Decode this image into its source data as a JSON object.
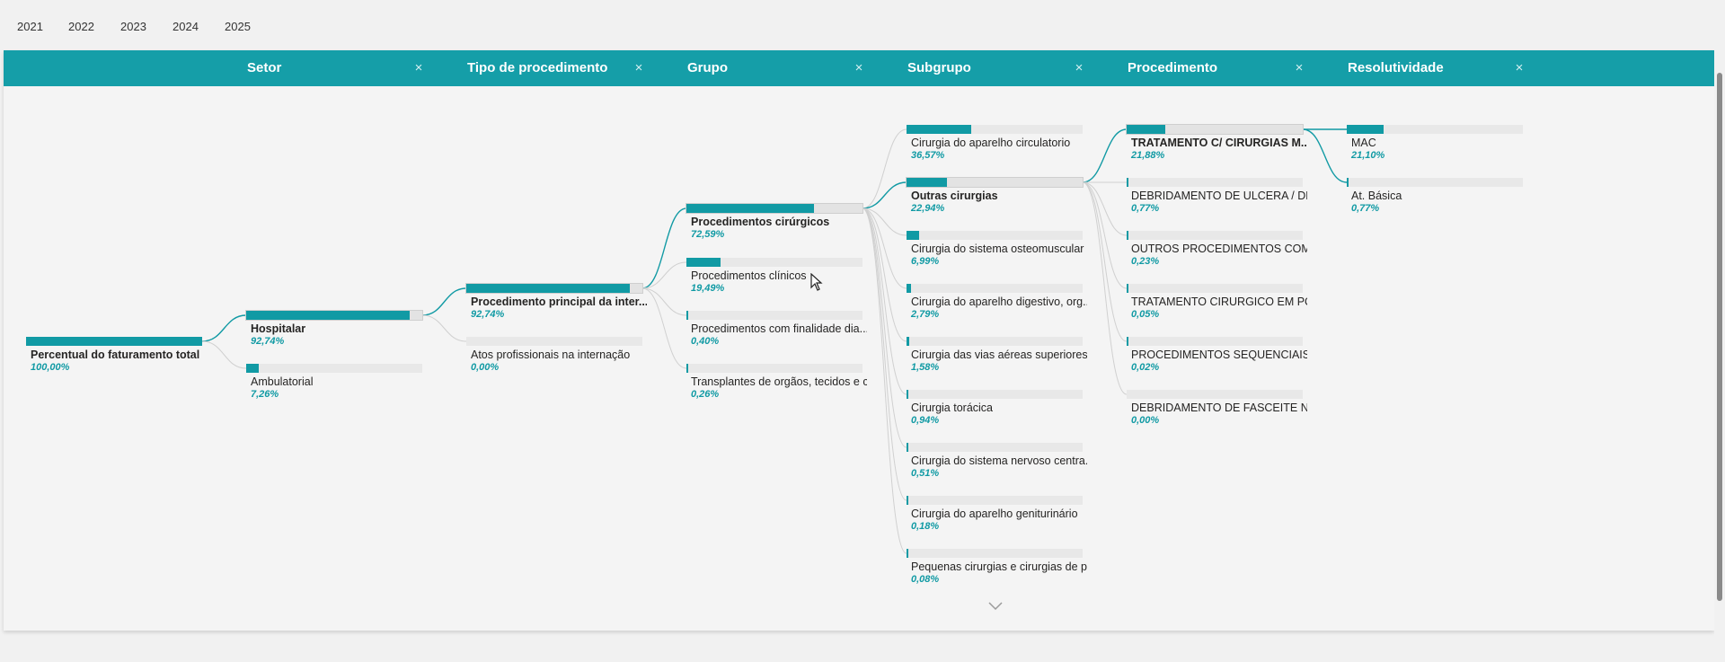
{
  "years": [
    "2021",
    "2022",
    "2023",
    "2024",
    "2025"
  ],
  "columns": [
    {
      "title": "Setor"
    },
    {
      "title": "Tipo de procedimento"
    },
    {
      "title": "Grupo"
    },
    {
      "title": "Subgrupo"
    },
    {
      "title": "Procedimento"
    },
    {
      "title": "Resolutividade"
    }
  ],
  "close_glyph": "×",
  "colors": {
    "accent": "#119aa4",
    "header": "#159ea8",
    "track": "#e8e8e8",
    "link_active": "#119aa4",
    "link_inactive": "#d0d0d0"
  },
  "tree": {
    "root": {
      "label": "Percentual do faturamento total",
      "pct": "100,00%",
      "value": 100.0
    },
    "setor": [
      {
        "label": "Hospitalar",
        "pct": "92,74%",
        "value": 92.74
      },
      {
        "label": "Ambulatorial",
        "pct": "7,26%",
        "value": 7.26
      }
    ],
    "tipo": [
      {
        "label": "Procedimento principal da inter...",
        "pct": "92,74%",
        "value": 92.74
      },
      {
        "label": "Atos profissionais na internação",
        "pct": "0,00%",
        "value": 0.0
      }
    ],
    "grupo": [
      {
        "label": "Procedimentos cirúrgicos",
        "pct": "72,59%",
        "value": 72.59
      },
      {
        "label": "Procedimentos clínicos",
        "pct": "19,49%",
        "value": 19.49
      },
      {
        "label": "Procedimentos com finalidade dia...",
        "pct": "0,40%",
        "value": 0.4
      },
      {
        "label": "Transplantes de orgãos, tecidos e c...",
        "pct": "0,26%",
        "value": 0.26
      }
    ],
    "subgrupo": [
      {
        "label": "Cirurgia do aparelho circulatorio",
        "pct": "36,57%",
        "value": 36.57
      },
      {
        "label": "Outras cirurgias",
        "pct": "22,94%",
        "value": 22.94
      },
      {
        "label": "Cirurgia do sistema osteomuscular",
        "pct": "6,99%",
        "value": 6.99
      },
      {
        "label": "Cirurgia do aparelho digestivo, org...",
        "pct": "2,79%",
        "value": 2.79
      },
      {
        "label": "Cirurgia das vias aéreas superiores,...",
        "pct": "1,58%",
        "value": 1.58
      },
      {
        "label": "Cirurgia torácica",
        "pct": "0,94%",
        "value": 0.94
      },
      {
        "label": "Cirurgia do sistema nervoso centra...",
        "pct": "0,51%",
        "value": 0.51
      },
      {
        "label": "Cirurgia do aparelho geniturinário",
        "pct": "0,18%",
        "value": 0.18
      },
      {
        "label": "Pequenas cirurgias e cirurgias de p...",
        "pct": "0,08%",
        "value": 0.08
      }
    ],
    "procedimento": [
      {
        "label": "TRATAMENTO C/ CIRURGIAS M...",
        "pct": "21,88%",
        "value": 21.88
      },
      {
        "label": "DEBRIDAMENTO DE ULCERA / DE ...",
        "pct": "0,77%",
        "value": 0.77
      },
      {
        "label": "OUTROS PROCEDIMENTOS COM C...",
        "pct": "0,23%",
        "value": 0.23
      },
      {
        "label": "TRATAMENTO CIRURGICO EM POLI...",
        "pct": "0,05%",
        "value": 0.05
      },
      {
        "label": "PROCEDIMENTOS SEQUENCIAIS E...",
        "pct": "0,02%",
        "value": 0.02
      },
      {
        "label": "DEBRIDAMENTO DE FASCEITE NEC...",
        "pct": "0,00%",
        "value": 0.0
      }
    ],
    "resolutividade": [
      {
        "label": "MAC",
        "pct": "21,10%",
        "value": 21.1
      },
      {
        "label": "At. Básica",
        "pct": "0,77%",
        "value": 0.77
      }
    ]
  }
}
